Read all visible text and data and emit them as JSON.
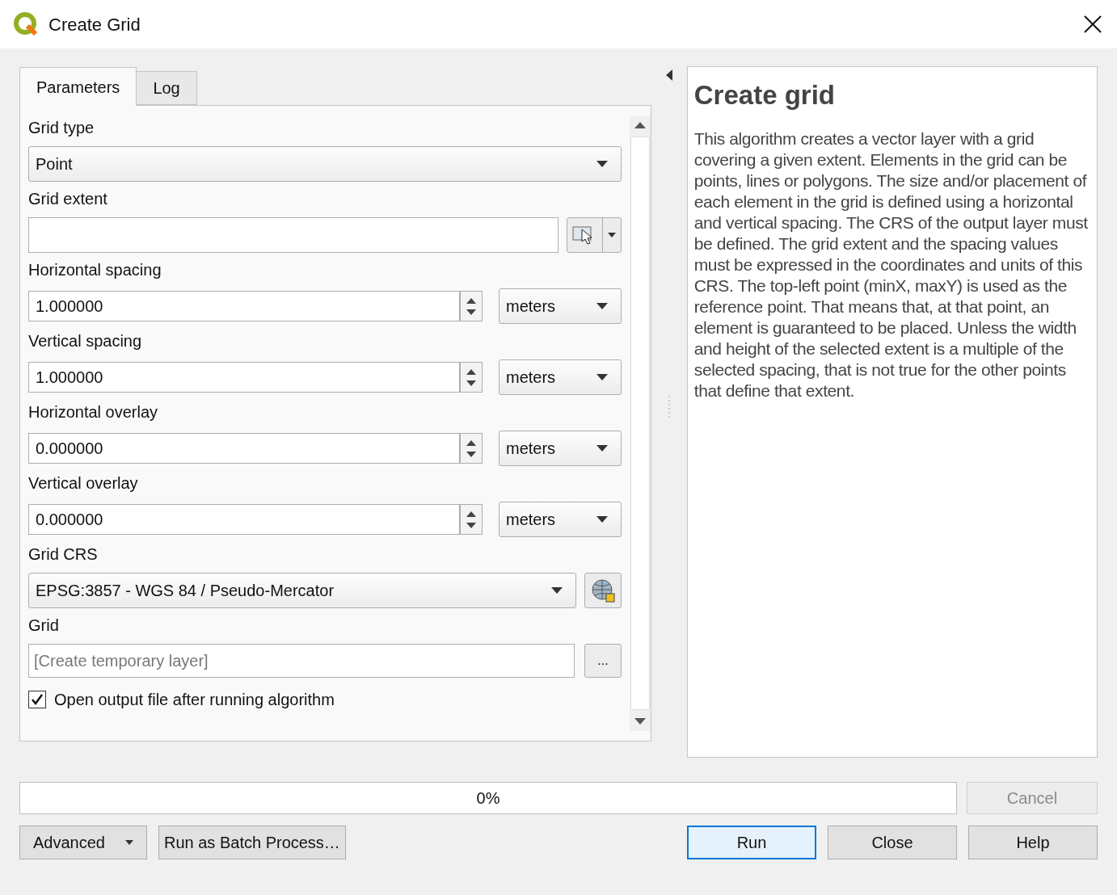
{
  "window": {
    "title": "Create Grid"
  },
  "tabs": [
    {
      "label": "Parameters",
      "selected": true
    },
    {
      "label": "Log",
      "selected": false
    }
  ],
  "parameters": [
    {
      "kind": "select",
      "label": "Grid type",
      "value": "Point"
    },
    {
      "kind": "extent",
      "label": "Grid extent"
    },
    {
      "kind": "number",
      "label": "Horizontal spacing",
      "value": "1.000000",
      "unit": "meters"
    },
    {
      "kind": "number",
      "label": "Vertical spacing",
      "value": "1.000000",
      "unit": "meters"
    },
    {
      "kind": "number",
      "label": "Horizontal overlay",
      "value": "0.000000",
      "unit": "meters"
    },
    {
      "kind": "number",
      "label": "Vertical overlay",
      "value": "0.000000",
      "unit": "meters"
    },
    {
      "kind": "crs",
      "label": "Grid CRS",
      "value": "EPSG:3857 - WGS 84 / Pseudo-Mercator"
    },
    {
      "kind": "output",
      "label": "Grid",
      "placeholder": "[Create temporary layer]",
      "button": "..."
    },
    {
      "kind": "checkbox",
      "label": "Open output file after running algorithm",
      "checked": true
    }
  ],
  "help": {
    "title": "Create grid",
    "text": "This algorithm creates a vector layer with a grid covering a given extent. Elements in the grid can be points, lines or polygons. The size and/or placement of each element in the grid is defined using a horizontal and vertical spacing. The CRS of the output layer must be defined. The grid extent and the spacing values must be expressed in the coordinates and units of this CRS. The top-left point (minX, maxY) is used as the reference point. That means that, at that point, an element is guaranteed to be placed. Unless the width and height of the selected extent is a multiple of the selected spacing, that is not true for the other points that define that extent."
  },
  "progress": {
    "level": 0,
    "reading": "0%"
  },
  "cancel": {
    "label": "Cancel",
    "disabled": true
  },
  "buttons": [
    {
      "kind": "menu",
      "label": "Advanced"
    },
    {
      "kind": "plain",
      "label": "Run as Batch Process…"
    },
    {
      "kind": "default",
      "label": "Run"
    },
    {
      "kind": "plain",
      "label": "Close"
    },
    {
      "kind": "plain",
      "label": "Help"
    }
  ]
}
